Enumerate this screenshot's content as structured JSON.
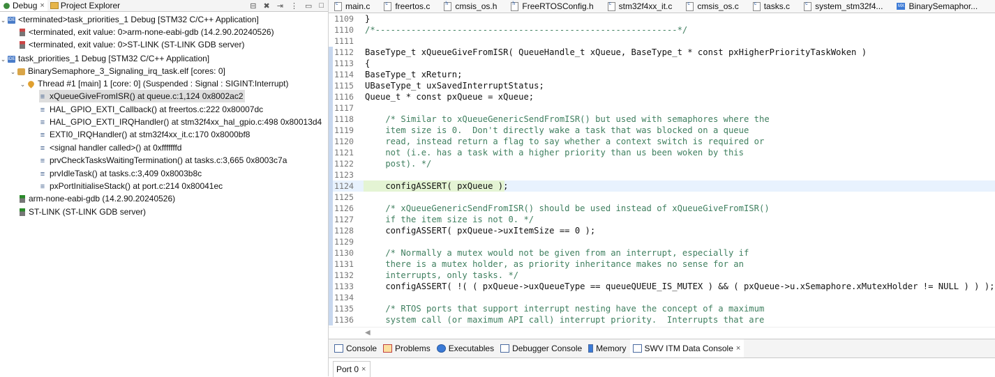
{
  "left_panel": {
    "tabs": [
      {
        "label": "Debug",
        "close": "×"
      },
      {
        "label": "Project Explorer"
      }
    ],
    "tree": [
      {
        "label": "<terminated>task_priorities_1 Debug [STM32 C/C++ Application]"
      },
      {
        "label": "<terminated, exit value: 0>arm-none-eabi-gdb (14.2.90.20240526)"
      },
      {
        "label": "<terminated, exit value: 0>ST-LINK (ST-LINK GDB server)"
      },
      {
        "label": "task_priorities_1 Debug [STM32 C/C++ Application]"
      },
      {
        "label": "BinarySemaphore_3_Signaling_irq_task.elf [cores: 0]"
      },
      {
        "label": "Thread #1 [main] 1 [core: 0] (Suspended : Signal : SIGINT:Interrupt)"
      },
      {
        "label": "xQueueGiveFromISR() at queue.c:1,124 0x8002ac2"
      },
      {
        "label": "HAL_GPIO_EXTI_Callback() at freertos.c:222 0x80007dc"
      },
      {
        "label": "HAL_GPIO_EXTI_IRQHandler() at stm32f4xx_hal_gpio.c:498 0x80013d4"
      },
      {
        "label": "EXTI0_IRQHandler() at stm32f4xx_it.c:170 0x8000bf8"
      },
      {
        "label": "<signal handler called>() at 0xfffffffd"
      },
      {
        "label": "prvCheckTasksWaitingTermination() at tasks.c:3,665 0x8003c7a"
      },
      {
        "label": "prvIdleTask() at tasks.c:3,409 0x8003b8c"
      },
      {
        "label": "pxPortInitialiseStack() at port.c:214 0x80041ec"
      },
      {
        "label": "arm-none-eabi-gdb (14.2.90.20240526)"
      },
      {
        "label": "ST-LINK (ST-LINK GDB server)"
      }
    ]
  },
  "editor": {
    "tabs": [
      {
        "label": "main.c"
      },
      {
        "label": "freertos.c"
      },
      {
        "label": "cmsis_os.h"
      },
      {
        "label": "FreeRTOSConfig.h"
      },
      {
        "label": "stm32f4xx_it.c"
      },
      {
        "label": "cmsis_os.c"
      },
      {
        "label": "tasks.c"
      },
      {
        "label": "system_stm32f4..."
      },
      {
        "label": "BinarySemaphor..."
      }
    ],
    "lines": [
      {
        "n": "1109",
        "text": "}"
      },
      {
        "n": "1110",
        "text": "/*-----------------------------------------------------------*/"
      },
      {
        "n": "1111",
        "text": ""
      },
      {
        "n": "1112",
        "text": "BaseType_t xQueueGiveFromISR( QueueHandle_t xQueue, BaseType_t * const pxHigherPriorityTaskWoken )"
      },
      {
        "n": "1113",
        "text": "{"
      },
      {
        "n": "1114",
        "text": "BaseType_t xReturn;"
      },
      {
        "n": "1115",
        "text": "UBaseType_t uxSavedInterruptStatus;"
      },
      {
        "n": "1116",
        "text": "Queue_t * const pxQueue = xQueue;"
      },
      {
        "n": "1117",
        "text": ""
      },
      {
        "n": "1118",
        "text": "    /* Similar to xQueueGenericSendFromISR() but used with semaphores where the"
      },
      {
        "n": "1119",
        "text": "    item size is 0.  Don't directly wake a task that was blocked on a queue"
      },
      {
        "n": "1120",
        "text": "    read, instead return a flag to say whether a context switch is required or"
      },
      {
        "n": "1121",
        "text": "    not (i.e. has a task with a higher priority than us been woken by this"
      },
      {
        "n": "1122",
        "text": "    post). */"
      },
      {
        "n": "1123",
        "text": ""
      },
      {
        "n": "1124",
        "text": "    configASSERT( pxQueue );"
      },
      {
        "n": "1125",
        "text": ""
      },
      {
        "n": "1126",
        "text": "    /* xQueueGenericSendFromISR() should be used instead of xQueueGiveFromISR()"
      },
      {
        "n": "1127",
        "text": "    if the item size is not 0. */"
      },
      {
        "n": "1128",
        "text": "    configASSERT( pxQueue->uxItemSize == 0 );"
      },
      {
        "n": "1129",
        "text": ""
      },
      {
        "n": "1130",
        "text": "    /* Normally a mutex would not be given from an interrupt, especially if"
      },
      {
        "n": "1131",
        "text": "    there is a mutex holder, as priority inheritance makes no sense for an"
      },
      {
        "n": "1132",
        "text": "    interrupts, only tasks. */"
      },
      {
        "n": "1133",
        "text": "    configASSERT( !( ( pxQueue->uxQueueType == queueQUEUE_IS_MUTEX ) && ( pxQueue->u.xSemaphore.xMutexHolder != NULL ) ) );"
      },
      {
        "n": "1134",
        "text": ""
      },
      {
        "n": "1135",
        "text": "    /* RTOS ports that support interrupt nesting have the concept of a maximum"
      },
      {
        "n": "1136",
        "text": "    system call (or maximum API call) interrupt priority.  Interrupts that are"
      }
    ]
  },
  "bottom_panel": {
    "tabs": [
      {
        "label": "Console"
      },
      {
        "label": "Problems"
      },
      {
        "label": "Executables"
      },
      {
        "label": "Debugger Console"
      },
      {
        "label": "Memory"
      },
      {
        "label": "SWV ITM Data Console",
        "close": "×"
      }
    ],
    "port_tab": {
      "label": "Port 0",
      "close": "×"
    }
  }
}
